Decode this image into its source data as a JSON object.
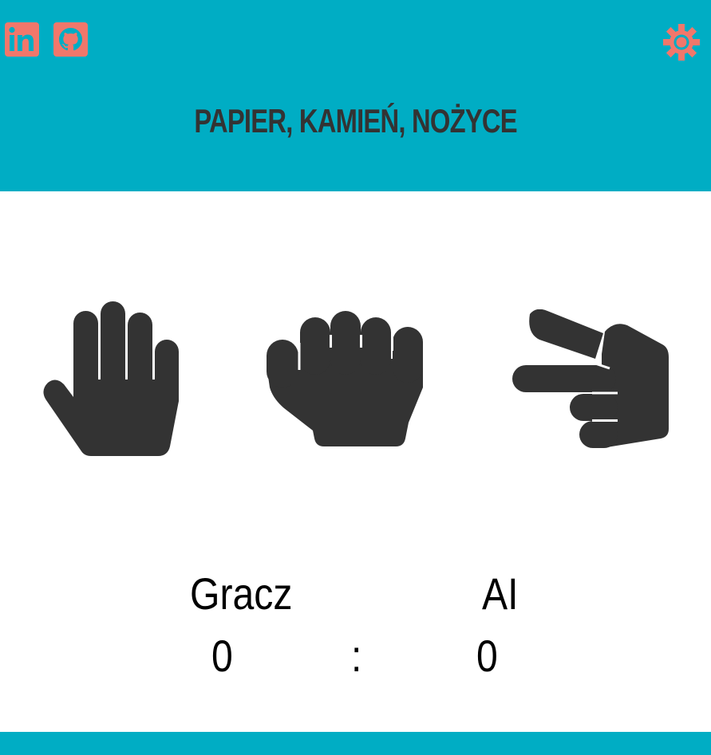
{
  "header": {
    "title": "PAPIER, KAMIEŃ, NOŻYCE",
    "links": [
      {
        "icon": "linkedin-icon"
      },
      {
        "icon": "github-icon"
      }
    ],
    "settings_icon": "gear-icon"
  },
  "choices": [
    {
      "icon": "hand-paper-icon"
    },
    {
      "icon": "hand-rock-icon"
    },
    {
      "icon": "hand-scissors-icon"
    }
  ],
  "score": {
    "player_label": "Gracz",
    "ai_label": "AI",
    "player_score": "0",
    "separator": ":",
    "ai_score": "0"
  },
  "colors": {
    "accent": "#00adc4",
    "icon": "#f1776b",
    "text": "#333333"
  }
}
